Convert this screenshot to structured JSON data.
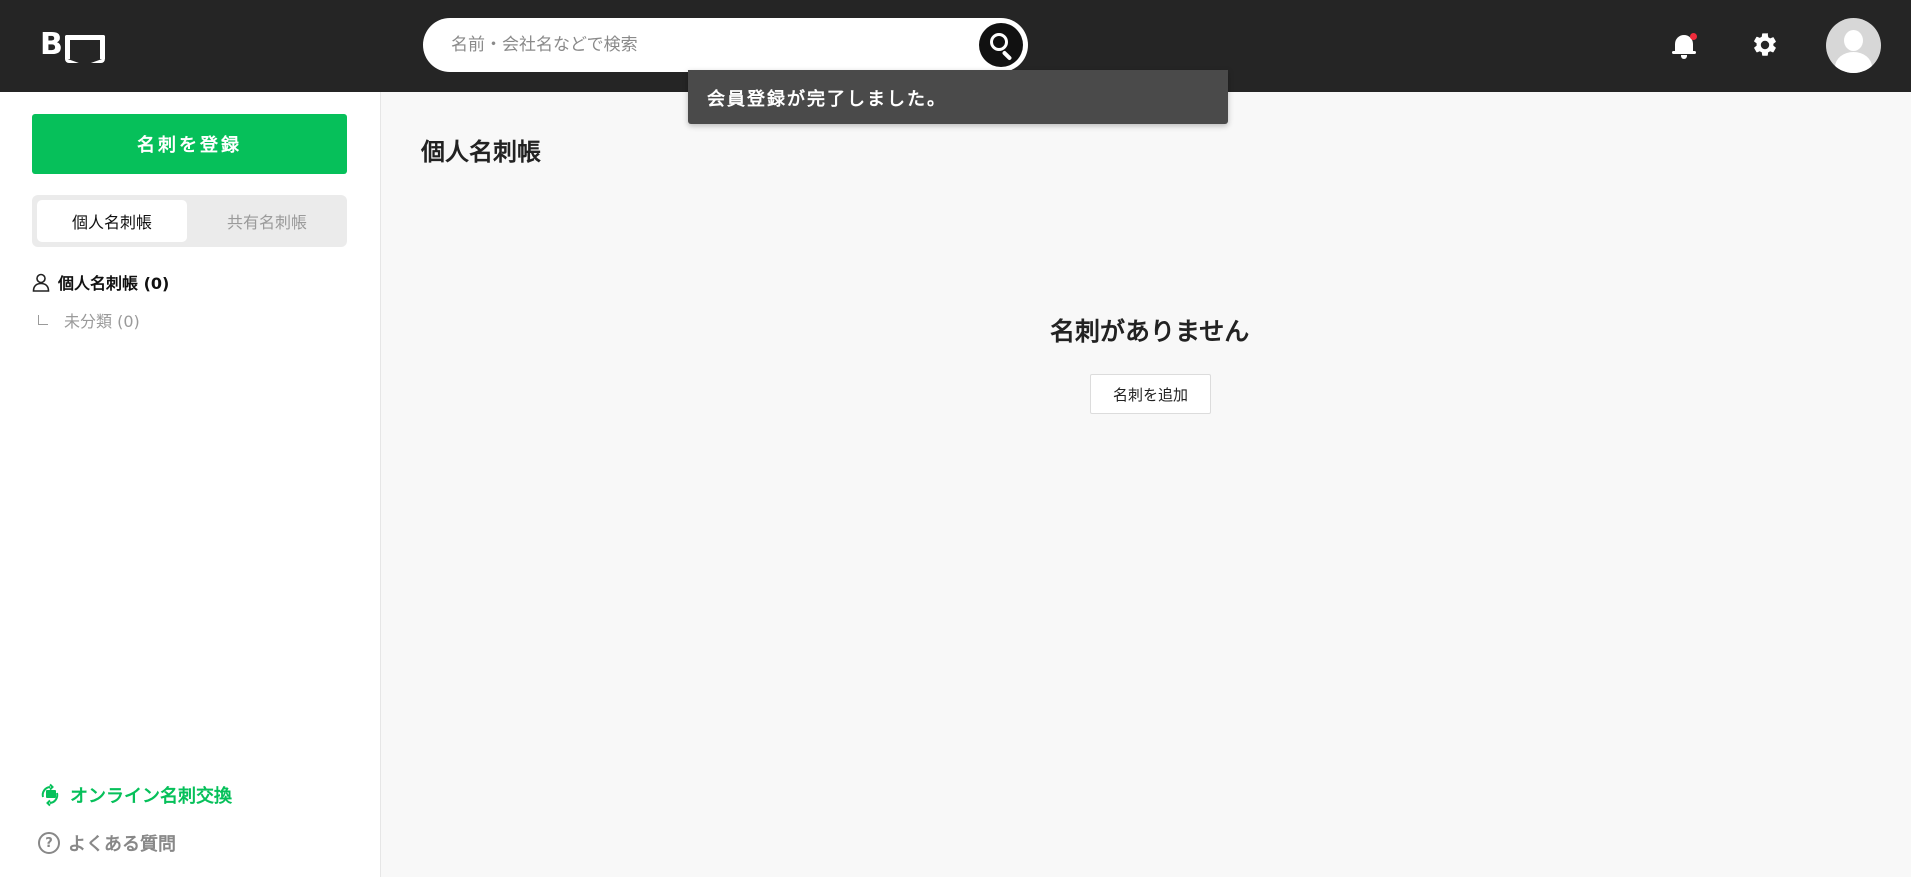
{
  "header": {
    "logo_text": "B",
    "search": {
      "placeholder": "名前・会社名などで検索",
      "value": ""
    },
    "notification_indicator_color": "#f02b3b",
    "background_color": "#252525"
  },
  "toast": {
    "message": "会員登録が完了しました。"
  },
  "sidebar": {
    "register_button_label": "名刺を登録",
    "accent_color": "#06c05a",
    "tabs": [
      {
        "label": "個人名刺帳",
        "selected": true
      },
      {
        "label": "共有名刺帳",
        "selected": false
      }
    ],
    "tree": {
      "root_label": "個人名刺帳 (0)",
      "children": [
        {
          "label": "未分類 (0)"
        }
      ]
    },
    "footer": {
      "exchange_label": "オンライン名刺交換",
      "faq_label": "よくある質問"
    }
  },
  "main": {
    "page_title": "個人名刺帳",
    "empty_state": {
      "title": "名刺がありません",
      "button_label": "名刺を追加"
    }
  },
  "icons": {
    "logo": "logo-icon",
    "search": "search-icon",
    "bell": "bell-icon",
    "gear": "gear-icon",
    "avatar": "avatar-icon",
    "person": "person-icon",
    "branch": "tree-branch-icon",
    "exchange": "card-exchange-icon",
    "faq": "question-circle-icon"
  }
}
